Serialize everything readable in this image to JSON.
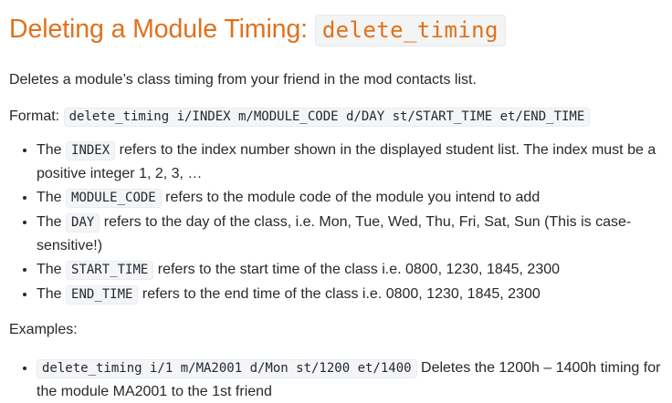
{
  "heading": {
    "text": "Deleting a Module Timing: ",
    "code": "delete_timing"
  },
  "description": "Deletes a module’s class timing from your friend in the mod contacts list.",
  "format": {
    "label": "Format: ",
    "code": "delete_timing i/INDEX m/MODULE_CODE d/DAY st/START_TIME et/END_TIME"
  },
  "params": [
    {
      "prefix": "The ",
      "code": "INDEX",
      "text": " refers to the index number shown in the displayed student list. The index must be a positive integer 1, 2, 3, …"
    },
    {
      "prefix": "The ",
      "code": "MODULE_CODE",
      "text": " refers to the module code of the module you intend to add"
    },
    {
      "prefix": "The ",
      "code": "DAY",
      "text": " refers to the day of the class, i.e. Mon, Tue, Wed, Thu, Fri, Sat, Sun (This is case-sensitive!)"
    },
    {
      "prefix": "The ",
      "code": "START_TIME",
      "text": " refers to the start time of the class i.e. 0800, 1230, 1845, 2300"
    },
    {
      "prefix": "The ",
      "code": "END_TIME",
      "text": " refers to the end time of the class i.e. 0800, 1230, 1845, 2300"
    }
  ],
  "examples_label": "Examples:",
  "examples": [
    {
      "code": "delete_timing i/1 m/MA2001 d/Mon st/1200 et/1400",
      "text": " Deletes the 1200h – 1400h timing for the module MA2001 to the 1st friend"
    }
  ]
}
